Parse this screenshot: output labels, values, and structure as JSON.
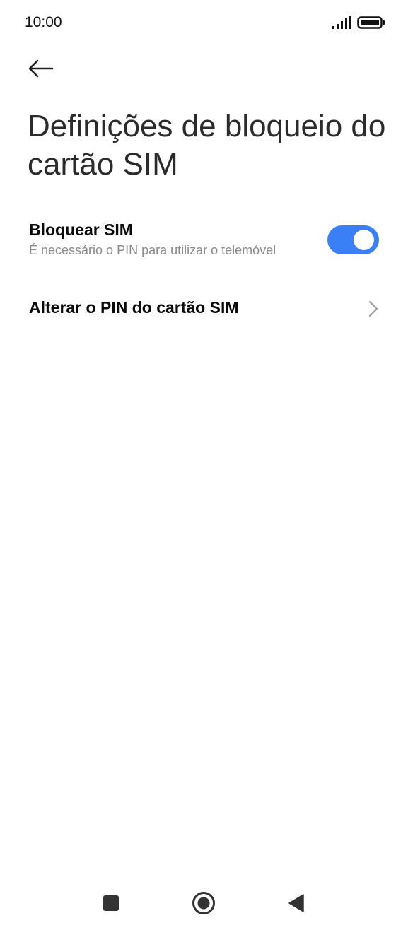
{
  "status_bar": {
    "time": "10:00",
    "icons": [
      "signal-icon",
      "battery-icon"
    ]
  },
  "header": {
    "back_icon": "arrow-left-icon",
    "title": "Definições de bloqueio do cartão SIM"
  },
  "settings": {
    "lock_sim": {
      "title": "Bloquear SIM",
      "subtitle": "É necessário o PIN para utilizar o telemóvel",
      "enabled": true
    },
    "change_pin": {
      "title": "Alterar o PIN do cartão SIM",
      "icon": "chevron-right-icon"
    }
  },
  "navigation_bar": {
    "icons": [
      "recents-square-icon",
      "home-circle-icon",
      "back-triangle-icon"
    ]
  },
  "colors": {
    "accent": "#3a7ff6",
    "title_text": "#2b2b2b",
    "subtitle_text": "#8a8a8a",
    "nav_icon": "#333333"
  }
}
